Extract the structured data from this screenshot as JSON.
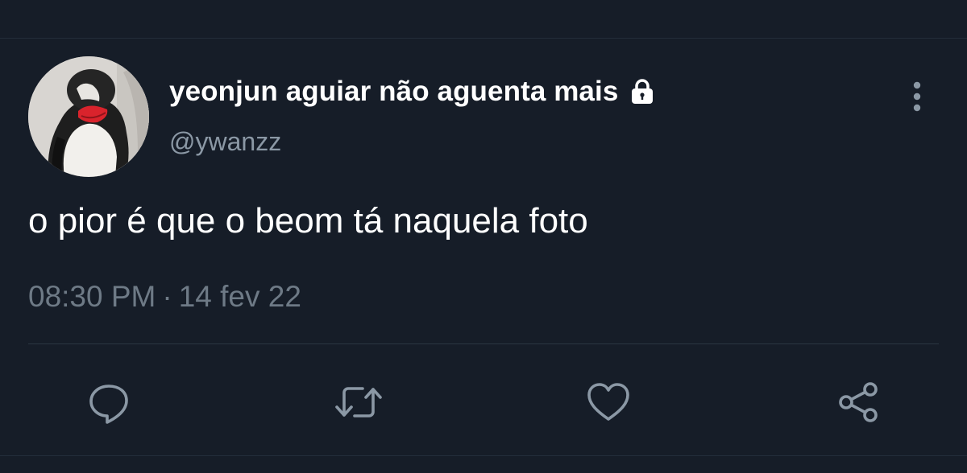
{
  "tweet": {
    "display_name": "yeonjun aguiar não aguenta mais",
    "handle": "@ywanzz",
    "text": "o pior é que o beom tá naquela foto",
    "time": "08:30 PM",
    "separator": "·",
    "date": "14 fev 22"
  },
  "icons": {
    "lock": "lock-icon",
    "more": "more-vertical-icon",
    "reply": "reply-icon",
    "retweet": "retweet-icon",
    "like": "heart-icon",
    "share": "share-icon"
  },
  "colors": {
    "background": "#161d28",
    "primary_text": "#ffffff",
    "secondary_text": "#8b98a5",
    "icon": "#8b98a5",
    "divider": "#2b3642"
  }
}
